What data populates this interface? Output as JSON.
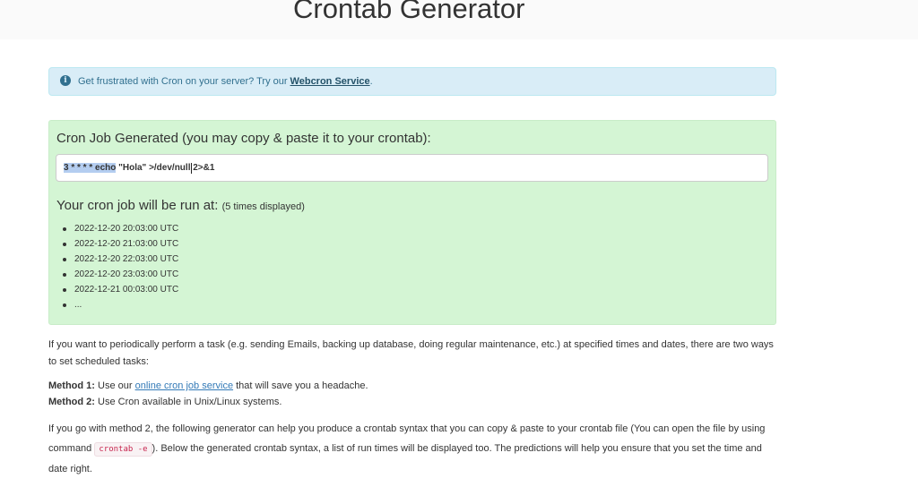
{
  "header": {
    "title": "Crontab Generator"
  },
  "alert": {
    "text": "Get frustrated with Cron on your server? Try our",
    "link_label": "Webcron Service",
    "trailing": "."
  },
  "result": {
    "heading": "Cron Job Generated (you may copy & paste it to your crontab):",
    "command_selected": "3 * * * * echo",
    "command_rest": " \"Hola\" >/dev/null 2>&1",
    "runs_heading": "Your cron job will be run at:",
    "runs_note": "(5 times displayed)",
    "run_times": [
      "2022-12-20 20:03:00 UTC",
      "2022-12-20 21:03:00 UTC",
      "2022-12-20 22:03:00 UTC",
      "2022-12-20 23:03:00 UTC",
      "2022-12-21 00:03:00 UTC",
      "..."
    ]
  },
  "content": {
    "intro": "If you want to periodically perform a task (e.g. sending Emails, backing up database, doing regular maintenance, etc.) at specified times and dates, there are two ways to set scheduled tasks:",
    "method1_label": "Method 1:",
    "method1_pre": "Use our",
    "method1_link": "online cron job service",
    "method1_post": "that will save you a headache.",
    "method2_label": "Method 2:",
    "method2_text": "Use Cron available in Unix/Linux systems.",
    "para2_pre": "If you go with method 2, the following generator can help you produce a crontab syntax that you can copy & paste to your crontab file (You can open the file by using command",
    "para2_code": "crontab -e",
    "para2_post": "). Below the generated crontab syntax, a list of run times will be displayed too. The predictions will help you ensure that you set the time and date right."
  }
}
